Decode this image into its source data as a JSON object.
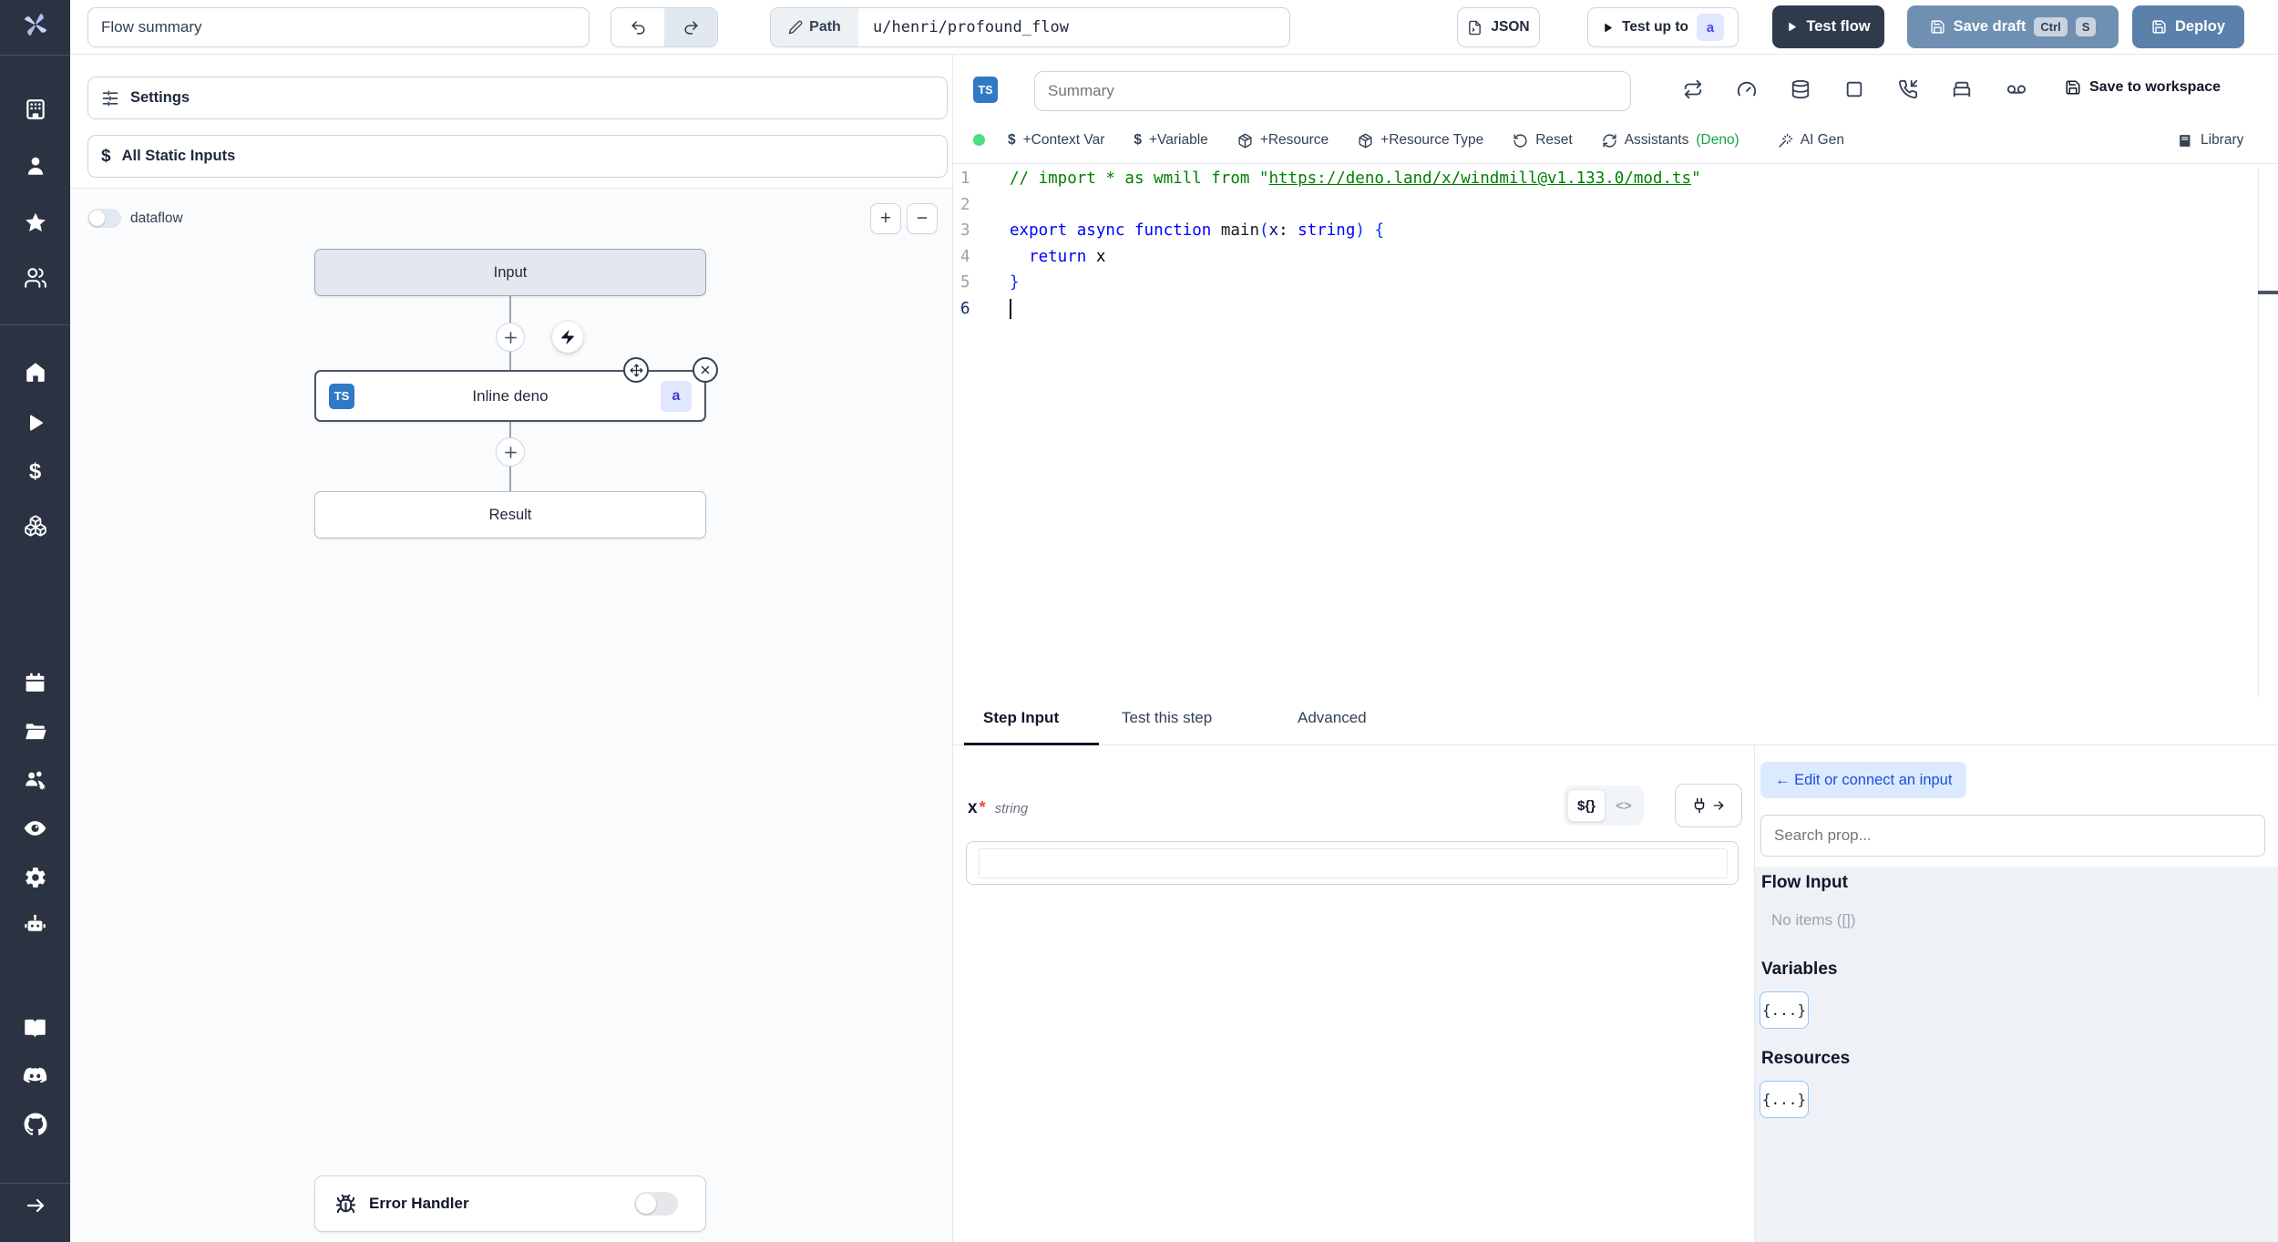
{
  "topbar": {
    "flow_summary_value": "Flow summary",
    "path_label": "Path",
    "path_value": "u/henri/profound_flow",
    "json_label": "JSON",
    "test_up_to_label": "Test up to",
    "step_badge": "a",
    "test_flow_label": "Test flow",
    "save_draft_label": "Save draft",
    "kbd": [
      "Ctrl",
      "S"
    ],
    "deploy_label": "Deploy"
  },
  "sidebar": {
    "icons": [
      "workspace",
      "user",
      "favorites",
      "user-groups",
      "home",
      "runs",
      "variables",
      "resources",
      "schedules",
      "folders",
      "groups",
      "audit-logs",
      "worker-settings",
      "ai-worker",
      "docs",
      "discord",
      "github",
      "expand"
    ]
  },
  "flow_panel": {
    "settings_label": "Settings",
    "static_inputs_label": "All Static Inputs",
    "dataflow_label": "dataflow",
    "zoom_in": "+",
    "zoom_out": "−",
    "graph": {
      "input": "Input",
      "step": "Inline deno",
      "lang": "TS",
      "step_id": "a",
      "result": "Result",
      "error_handler": "Error Handler"
    }
  },
  "editor": {
    "lang_badge": "TS",
    "summary_placeholder": "Summary",
    "save_to_workspace": "Save to workspace",
    "toolbar": {
      "context_var": "+Context Var",
      "variable": "+Variable",
      "resource": "+Resource",
      "resource_type": "+Resource Type",
      "reset": "Reset",
      "assistants": "Assistants",
      "assistants_lang": "(Deno)",
      "ai_gen": "AI Gen",
      "library": "Library"
    },
    "code": {
      "lines": [
        {
          "num": "1",
          "tokens": [
            {
              "c": "comment",
              "t": "// import * as wmill from \""
            },
            {
              "c": "comment-link",
              "t": "https://deno.land/x/windmill@v1.133.0/mod.ts"
            },
            {
              "c": "comment",
              "t": "\""
            }
          ]
        },
        {
          "num": "2",
          "tokens": []
        },
        {
          "num": "3",
          "tokens": [
            {
              "c": "kw",
              "t": "export"
            },
            {
              "c": "pl",
              "t": " "
            },
            {
              "c": "kw",
              "t": "async"
            },
            {
              "c": "pl",
              "t": " "
            },
            {
              "c": "kw",
              "t": "function"
            },
            {
              "c": "fn",
              "t": " main"
            },
            {
              "c": "pr",
              "t": "("
            },
            {
              "c": "pm",
              "t": "x"
            },
            {
              "c": "pl",
              "t": ": "
            },
            {
              "c": "kw",
              "t": "string"
            },
            {
              "c": "pr",
              "t": ") {"
            }
          ]
        },
        {
          "num": "4",
          "tokens": [
            {
              "c": "pl",
              "t": "  "
            },
            {
              "c": "kw",
              "t": "return"
            },
            {
              "c": "pl",
              "t": " x"
            }
          ]
        },
        {
          "num": "5",
          "tokens": [
            {
              "c": "pr",
              "t": "}"
            }
          ]
        },
        {
          "num": "6",
          "active": true,
          "cursor": true,
          "tokens": []
        }
      ]
    }
  },
  "bottom": {
    "tabs": [
      "Step Input",
      "Test this step",
      "Advanced"
    ],
    "field": {
      "name": "x",
      "required": "*",
      "type": "string"
    },
    "expr_toggle": "${}",
    "code_toggle": "<>",
    "connect": {
      "edit_button": "← Edit or connect an input",
      "search_placeholder": "Search prop...",
      "flow_input_title": "Flow Input",
      "flow_input_empty": "No items ([])",
      "variables_title": "Variables",
      "variables_chip": "{...}",
      "resources_title": "Resources",
      "resources_chip": "{...}"
    }
  },
  "colors": {
    "sidebar_bg": "#2b3342",
    "test_flow_bg": "#2f3a4d",
    "save_draft_bg": "#7090b2",
    "deploy_bg": "#5b81ab",
    "ts_badge": "#3178c6",
    "step_badge_bg": "#e0e7ff",
    "step_badge_text": "#4f46e5",
    "green_dot": "#4ade80",
    "deno_green": "#16a34a",
    "edit_button_bg": "#dbeafe",
    "edit_button_text": "#1d4ed8"
  }
}
